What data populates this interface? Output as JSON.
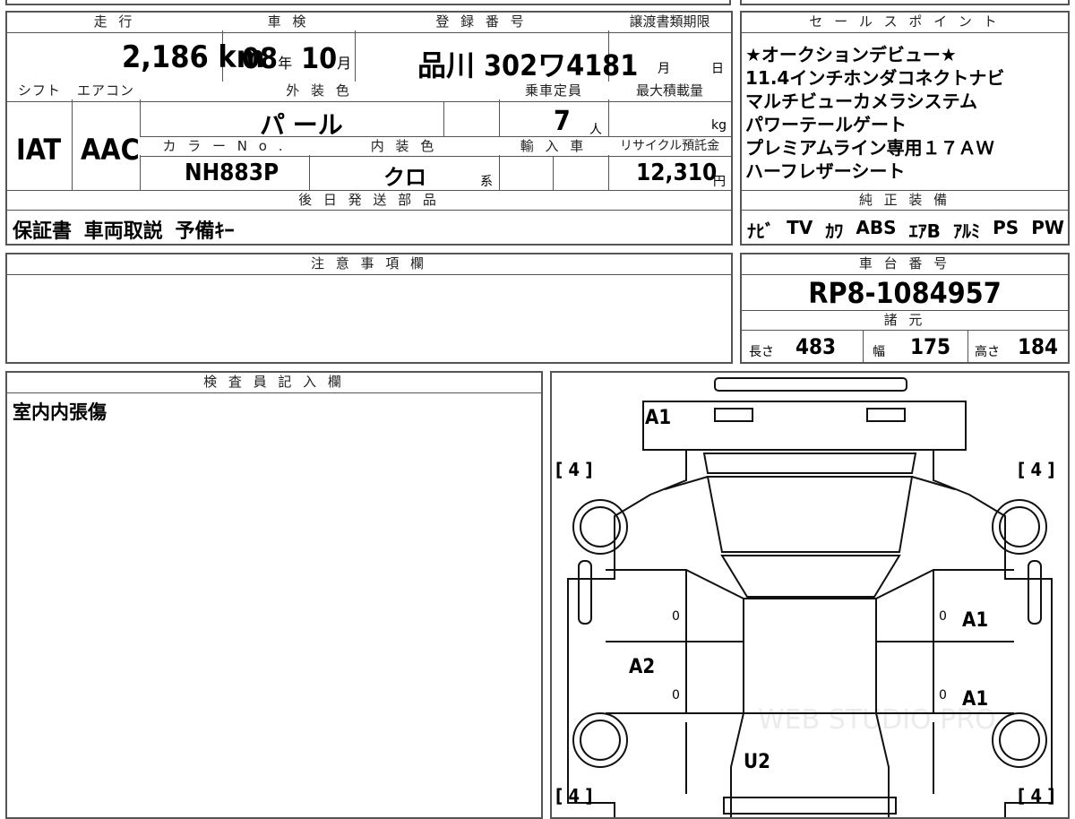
{
  "top": {
    "mileage_label": "走 行",
    "mileage_value": "2,186",
    "mileage_unit": "km",
    "shaken_label": "車 検",
    "shaken_year": "08",
    "shaken_year_unit": "年",
    "shaken_month": "10",
    "shaken_month_unit": "月",
    "reg_label": "登 録 番 号",
    "reg_value": "品川 302ワ4181",
    "transfer_label": "譲渡書類期限",
    "transfer_month_unit": "月",
    "transfer_day_unit": "日",
    "shift_label": "シフト",
    "shift_value": "IAT",
    "ac_label": "エアコン",
    "ac_value": "AAC",
    "ext_color_label": "外 装 色",
    "ext_color_value": "パ ール",
    "capacity_label": "乗車定員",
    "capacity_value": "7",
    "capacity_unit": "人",
    "max_load_label": "最大積載量",
    "max_load_unit": "kg",
    "color_no_label": "カ ラ ー N o .",
    "color_no_value": "NH883P",
    "int_color_label": "内 装 色",
    "int_color_value": "クロ",
    "int_color_unit": "系",
    "import_label": "輸 入 車",
    "recycle_label": "リサイクル預託金",
    "recycle_value": "12,310",
    "recycle_unit": "円",
    "later_parts_label": "後 日 発 送 部 品",
    "later_parts_value": "保証書  車両取説  予備ｷｰ"
  },
  "sales": {
    "label": "セ ー ル ス ポ イ ン ト",
    "lines": [
      "★オークションデビュー★",
      "11.4インチホンダコネクトナビ",
      "マルチビューカメラシステム",
      "パワーテールゲート",
      "プレミアムライン専用１７ＡＷ",
      "ハーフレザーシート"
    ]
  },
  "equipment": {
    "label": "純 正 装 備",
    "items": [
      "ﾅﾋﾞ",
      "TV",
      "ｶﾜ",
      "ABS",
      "ｴｱB",
      "ｱﾙﾐ",
      "PS",
      "PW"
    ]
  },
  "notes": {
    "label": "注 意 事 項 欄",
    "value": ""
  },
  "chassis": {
    "label": "車 台 番 号",
    "value": "RP8-1084957",
    "specs_label": "諸 元",
    "length_label": "長さ",
    "length_value": "483",
    "width_label": "幅",
    "width_value": "175",
    "height_label": "高さ",
    "height_value": "184"
  },
  "inspector": {
    "label": "検 査 員 記 入 欄",
    "value": "室内内張傷"
  },
  "diagram": {
    "marks": {
      "a1_top": "A1",
      "a1_right_front": "A1",
      "a1_right_rear": "A1",
      "a2_left": "A2",
      "u2_rear": "U2",
      "zero_lf": "0",
      "zero_lr": "0",
      "zero_rf": "0",
      "zero_rr": "0"
    },
    "tire_fl": "[ 4 ]",
    "tire_fr": "[ 4 ]",
    "tire_rl": "[ 4 ]",
    "tire_rr": "[ 4 ]",
    "watermark": "WEB STUDIO PRO"
  }
}
